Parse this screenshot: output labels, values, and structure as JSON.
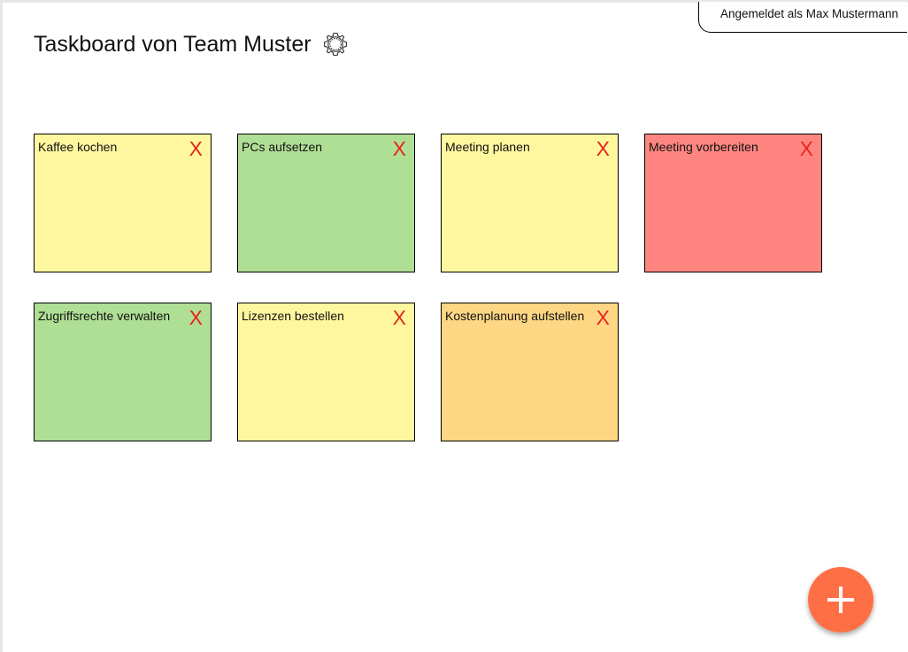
{
  "user": {
    "logged_in_text": "Angemeldet als Max Mustermann"
  },
  "board": {
    "title": "Taskboard von Team Muster",
    "settings_icon": "gear-icon"
  },
  "cards": [
    {
      "title": "Kaffee kochen",
      "color": "#fff7a0",
      "delete_label": "X"
    },
    {
      "title": "PCs aufsetzen",
      "color": "#afde95",
      "delete_label": "X"
    },
    {
      "title": "Meeting planen",
      "color": "#fff7a0",
      "delete_label": "X"
    },
    {
      "title": "Meeting vorbereiten",
      "color": "#ff8680",
      "delete_label": "X"
    },
    {
      "title": "Zugriffsrechte verwalten",
      "color": "#afde95",
      "delete_label": "X"
    },
    {
      "title": "Lizenzen bestellen",
      "color": "#fff7a0",
      "delete_label": "X"
    },
    {
      "title": "Kostenplanung aufstellen",
      "color": "#ffd684",
      "delete_label": "X"
    }
  ],
  "add_button": {
    "icon": "plus-icon",
    "color": "#ff6f45"
  },
  "colors": {
    "delete_x": "#e8261a",
    "frame": "#e6e6e6"
  }
}
